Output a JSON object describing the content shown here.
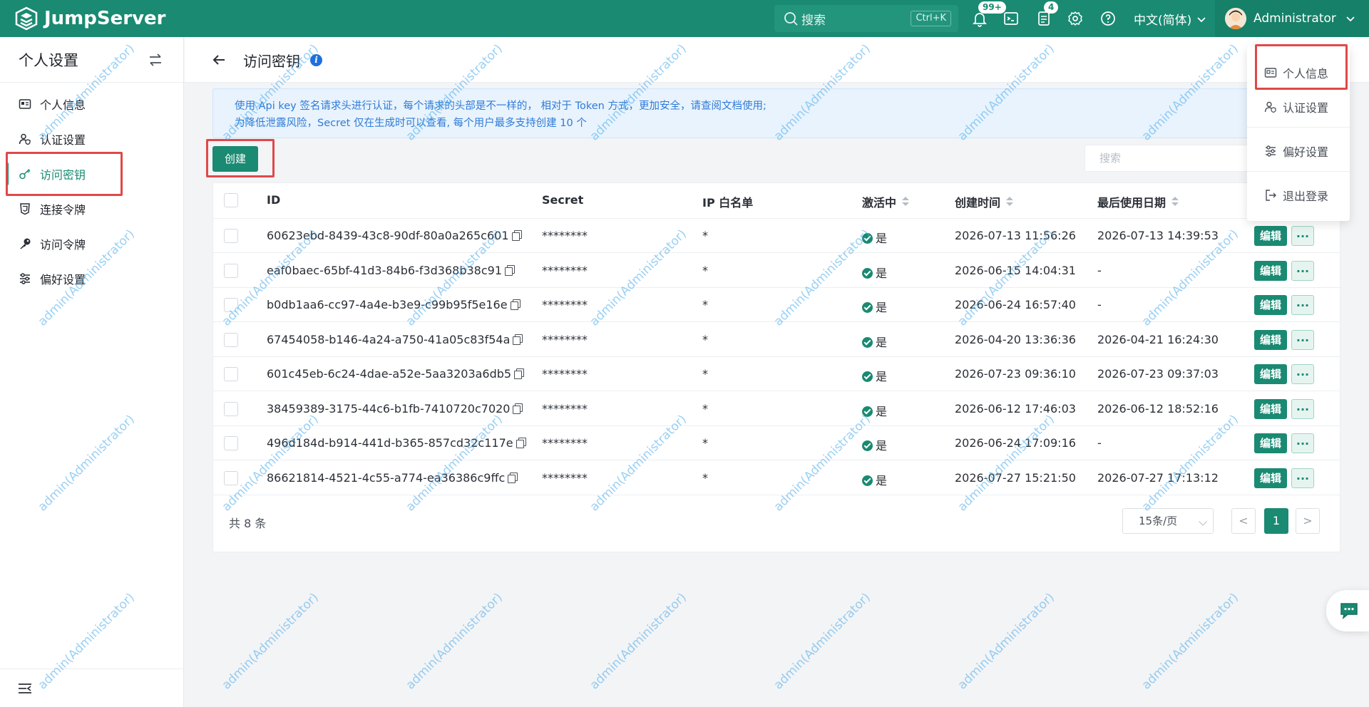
{
  "brand": {
    "name": "JumpServer"
  },
  "topbar": {
    "search_placeholder": "搜索",
    "search_shortcut": "Ctrl+K",
    "notification_badge": "99+",
    "tickets_badge": "4",
    "language": "中文(简体)",
    "user_name": "Administrator"
  },
  "sidebar": {
    "title": "个人设置",
    "items": [
      {
        "label": "个人信息",
        "icon": "id-card-icon"
      },
      {
        "label": "认证设置",
        "icon": "user-shield-icon"
      },
      {
        "label": "访问密钥",
        "icon": "key-outline-icon",
        "active": true
      },
      {
        "label": "连接令牌",
        "icon": "token-icon"
      },
      {
        "label": "访问令牌",
        "icon": "key-solid-icon"
      },
      {
        "label": "偏好设置",
        "icon": "sliders-icon"
      }
    ]
  },
  "page": {
    "title": "访问密钥",
    "alert_line1": "使用 Api key 签名请求头进行认证，每个请求的头部是不一样的， 相对于 Token 方式，更加安全，请查阅文档使用;",
    "alert_line2": "为降低泄露风险，Secret 仅在生成时可以查看, 每个用户最多支持创建 10 个"
  },
  "toolbar": {
    "create_label": "创建",
    "search_placeholder": "搜索"
  },
  "table": {
    "columns": {
      "id": "ID",
      "secret": "Secret",
      "ip_whitelist": "IP 白名单",
      "active": "激活中",
      "created": "创建时间",
      "last_used": "最后使用日期"
    },
    "rows": [
      {
        "id": "60623ebd-8439-43c8-90df-80a0a265c601",
        "secret": "********",
        "ip": "*",
        "active": "是",
        "created": "2026-07-13 11:56:26",
        "last_used": "2026-07-13 14:39:53"
      },
      {
        "id": "eaf0baec-65bf-41d3-84b6-f3d368b38c91",
        "secret": "********",
        "ip": "*",
        "active": "是",
        "created": "2026-06-15 14:04:31",
        "last_used": "-"
      },
      {
        "id": "b0db1aa6-cc97-4a4e-b3e9-c99b95f5e16e",
        "secret": "********",
        "ip": "*",
        "active": "是",
        "created": "2026-06-24 16:57:40",
        "last_used": "-"
      },
      {
        "id": "67454058-b146-4a24-a750-41a05c83f54a",
        "secret": "********",
        "ip": "*",
        "active": "是",
        "created": "2026-04-20 13:36:36",
        "last_used": "2026-04-21 16:24:30"
      },
      {
        "id": "601c45eb-6c24-4dae-a52e-5aa3203a6db5",
        "secret": "********",
        "ip": "*",
        "active": "是",
        "created": "2026-07-23 09:36:10",
        "last_used": "2026-07-23 09:37:03"
      },
      {
        "id": "38459389-3175-44c6-b1fb-7410720c7020",
        "secret": "********",
        "ip": "*",
        "active": "是",
        "created": "2026-06-12 17:46:03",
        "last_used": "2026-06-12 18:52:16"
      },
      {
        "id": "496d184d-b914-441d-b365-857cd32c117e",
        "secret": "********",
        "ip": "*",
        "active": "是",
        "created": "2026-06-24 17:09:16",
        "last_used": "-"
      },
      {
        "id": "86621814-4521-4c55-a774-ea36386c9ffc",
        "secret": "********",
        "ip": "*",
        "active": "是",
        "created": "2026-07-27 15:21:50",
        "last_used": "2026-07-27 17:13:12"
      }
    ],
    "edit_label": "编辑",
    "more_label": "..."
  },
  "pagination": {
    "total": "共 8 条",
    "page_size": "15条/页",
    "prev": "<",
    "current": "1",
    "next": ">"
  },
  "dropdown": {
    "items": [
      {
        "label": "个人信息",
        "icon": "id-card-icon"
      },
      {
        "label": "认证设置",
        "icon": "user-shield-icon"
      },
      {
        "label": "偏好设置",
        "icon": "sliders-icon"
      },
      {
        "label": "退出登录",
        "icon": "logout-icon"
      }
    ]
  },
  "watermark": "admin(Administrator)",
  "colors": {
    "brand": "#1a8a72",
    "highlight": "#e04848",
    "alert_text": "#2f7bd6",
    "watermark": "#46aaeb"
  }
}
